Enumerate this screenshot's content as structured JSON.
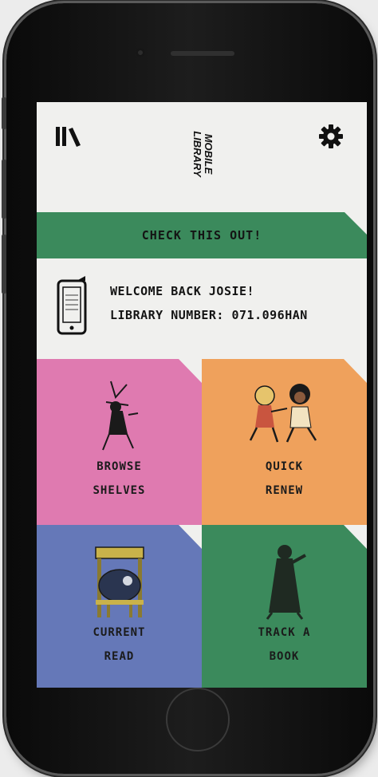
{
  "header": {
    "logo_line1": "MOBILE",
    "logo_line2": "LIBRARY",
    "menu_icon": "library-books-icon",
    "settings_icon": "gear-icon"
  },
  "banner": {
    "label": "CHECK THIS OUT!"
  },
  "welcome": {
    "greeting": "WELCOME BACK JOSIE!",
    "library_number": "LIBRARY NUMBER: 071.096HAN",
    "icon": "phone-card-icon"
  },
  "tiles": [
    {
      "line1": "BROWSE",
      "line2": "SHELVES",
      "color": "#df7ab0"
    },
    {
      "line1": "QUICK",
      "line2": "RENEW",
      "color": "#efa15c"
    },
    {
      "line1": "CURRENT",
      "line2": "READ",
      "color": "#6578b8"
    },
    {
      "line1": "TRACK A",
      "line2": "BOOK",
      "color": "#3b8a5c"
    }
  ],
  "colors": {
    "accent_green": "#3b8a5c",
    "screen_bg": "#f0f0ee"
  }
}
